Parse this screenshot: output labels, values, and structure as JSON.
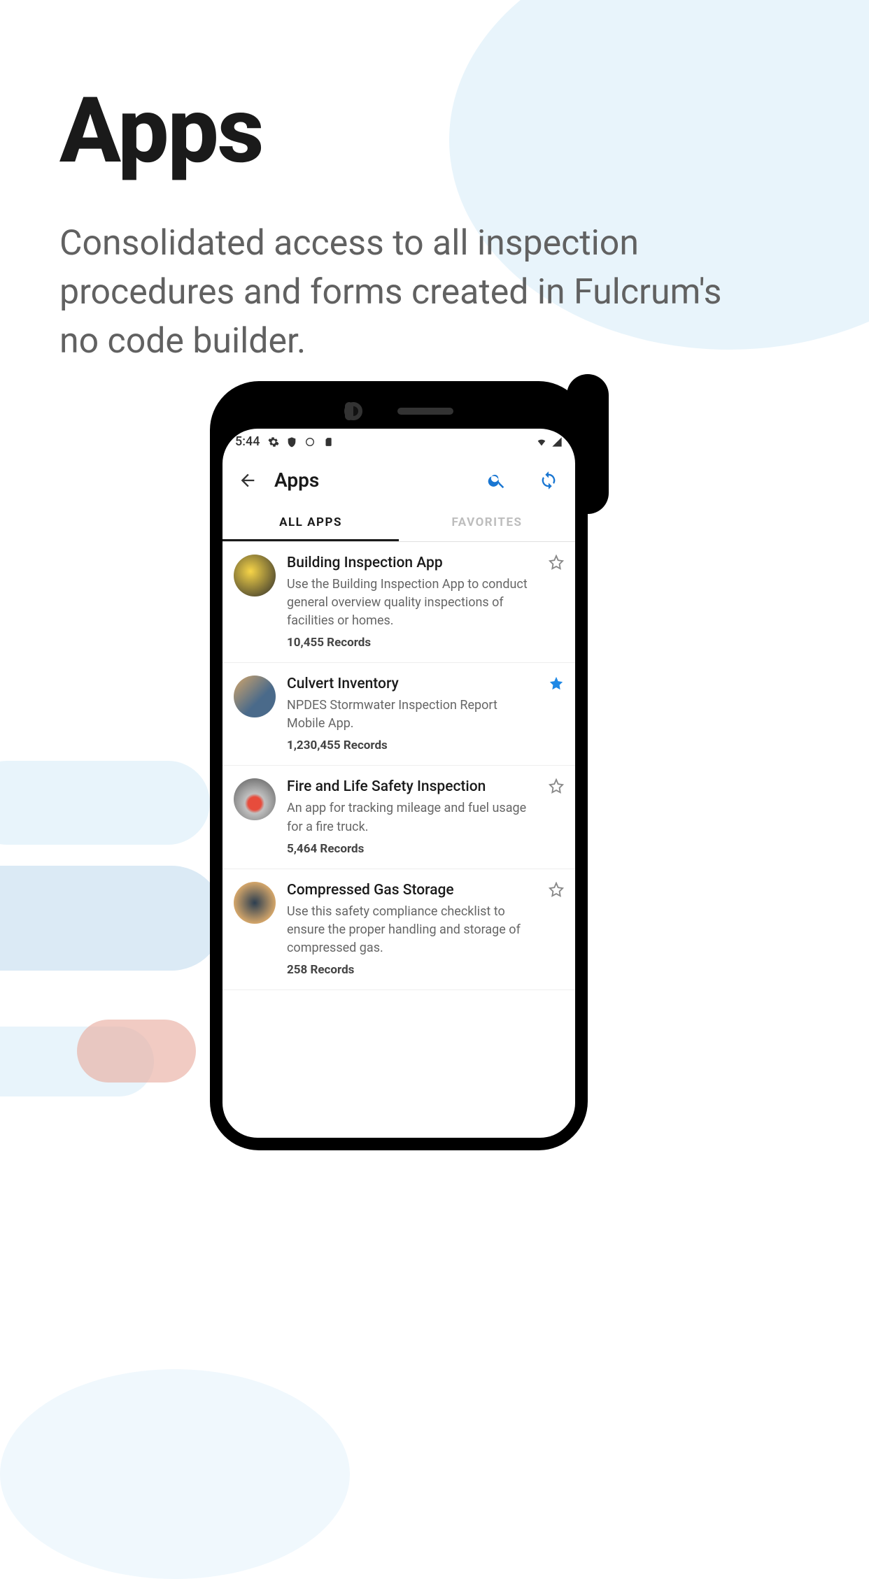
{
  "hero": {
    "title": "Apps",
    "subtitle": "Consolidated access to all inspection procedures and forms created in Fulcrum's no code builder."
  },
  "statusbar": {
    "time": "5:44"
  },
  "header": {
    "title": "Apps"
  },
  "tabs": [
    {
      "label": "ALL APPS",
      "active": true
    },
    {
      "label": "FAVORITES",
      "active": false
    }
  ],
  "apps": [
    {
      "name": "Building Inspection App",
      "description": "Use the Building Inspection App to conduct general overview quality inspections of facilities or homes.",
      "records": "10,455 Records",
      "starred": false
    },
    {
      "name": "Culvert Inventory",
      "description": "NPDES Stormwater Inspection Report Mobile App.",
      "records": "1,230,455 Records",
      "starred": true
    },
    {
      "name": "Fire and Life Safety Inspection",
      "description": "An app for tracking mileage and fuel usage for a fire truck.",
      "records": "5,464 Records",
      "starred": false
    },
    {
      "name": "Compressed Gas Storage",
      "description": "Use this safety compliance checklist to ensure the proper handling and storage of compressed gas.",
      "records": "258 Records",
      "starred": false
    }
  ]
}
